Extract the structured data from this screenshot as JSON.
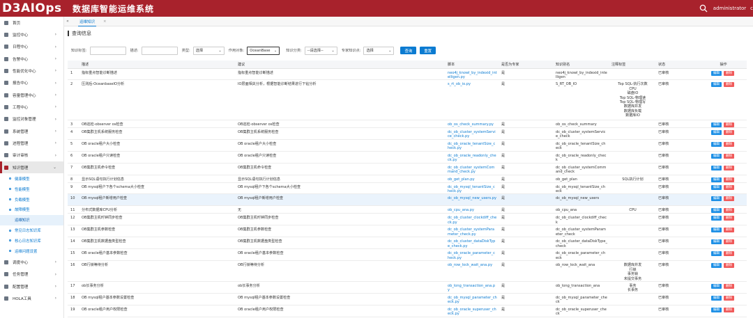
{
  "header": {
    "logo": "D3AIOps",
    "title": "数据库智能运维系统",
    "user": "administrator",
    "user_suffix": "c",
    "icons": {
      "search": "search-icon"
    }
  },
  "sidebar": {
    "items": [
      {
        "label": "首页",
        "icon": "home-icon",
        "chev": false
      },
      {
        "label": "监控中心",
        "icon": "monitor-icon",
        "chev": true
      },
      {
        "label": "日程中心",
        "icon": "calendar-icon",
        "chev": true
      },
      {
        "label": "告警中心",
        "icon": "alarm-icon",
        "chev": true
      },
      {
        "label": "性能优化中心",
        "icon": "performance-icon",
        "chev": true
      },
      {
        "label": "报告中心",
        "icon": "report-icon",
        "chev": true
      },
      {
        "label": "容量管理中心",
        "icon": "capacity-icon",
        "chev": true
      },
      {
        "label": "工程中心",
        "icon": "project-icon",
        "chev": true
      },
      {
        "label": "监控对象管理",
        "icon": "target-icon",
        "chev": true
      },
      {
        "label": "系统管理",
        "icon": "gear-icon",
        "chev": true
      },
      {
        "label": "进程管理",
        "icon": "process-icon",
        "chev": true
      },
      {
        "label": "审计审核",
        "icon": "audit-icon",
        "chev": true
      },
      {
        "label": "知识管理",
        "icon": "knowledge-icon",
        "chev": true,
        "active": true
      }
    ],
    "subitems": [
      "健康模型",
      "性能模型",
      "负载模型",
      "故障模型",
      "运维知识",
      "常见日志知识库",
      "核心日志知识库",
      "运维问题设置"
    ],
    "current_sub": 4,
    "items2": [
      {
        "label": "调度中心",
        "icon": "schedule-icon",
        "chev": true
      },
      {
        "label": "任务管理",
        "icon": "task-icon",
        "chev": true
      },
      {
        "label": "配置管理",
        "icon": "config-icon",
        "chev": true
      },
      {
        "label": "HOLA工具",
        "icon": "tool-icon",
        "chev": true
      }
    ]
  },
  "tabs": {
    "collapse": "«",
    "active": "运维知识",
    "close": "×"
  },
  "page": {
    "section_title": "查询信息"
  },
  "filters": {
    "f1_label": "知识标签:",
    "f2_label": "描述:",
    "f3_label": "类型:",
    "f3_value": "选择",
    "f4_label": "作用对象:",
    "f4_value": "OceanBase",
    "f5_label": "知识分类:",
    "f5_value": "--请选择--",
    "f6_label": "专家知识点:",
    "f6_value": "选择",
    "query": "查询",
    "reset": "重置"
  },
  "table": {
    "headers": [
      "",
      "描述",
      "建议",
      "脚本",
      "是否为专家",
      "知识别名",
      "注释标签",
      "状态",
      "操作"
    ],
    "edit": "编辑",
    "del": "删除",
    "rows": [
      {
        "n": "1",
        "desc": "指标重点智能诊断描述",
        "adv": "指标重点智能诊断描述",
        "script": "neo4j_knowl_by_indexid_intelligen.py",
        "exp": "是",
        "alias": "neo4j_knowl_by_indexid_intelligen",
        "tag": "",
        "status": "已审核"
      },
      {
        "n": "2",
        "desc": "压测后-OceanbaseIO分析",
        "adv": "IO层面相关分析，根据智能诊断结果进行下钻分析",
        "script": "s_rt_ob_io.py",
        "exp": "是",
        "alias": "S_RT_OB_IO",
        "tag": "Top SQL-执行次数\nCPU\n磁盘IO\nTop SQL-物理读\nTop SQL-物理写\n数据库并发\n数据库负载\n数据库IO",
        "status": "已审核"
      },
      {
        "n": "3",
        "desc": "OB巡检-observer os检查",
        "adv": "OB巡检-observer os检查",
        "script": "ob_os_check_summary.py",
        "exp": "是",
        "alias": "ob_os_check_summary",
        "tag": "",
        "status": "已审核"
      },
      {
        "n": "4",
        "desc": "OB集群主机系统服务检查",
        "adv": "OB集群主机系统服务检查",
        "script": "dc_ob_cluster_systemService_check.py",
        "exp": "是",
        "alias": "dc_ob_cluster_systemService_check",
        "tag": "",
        "status": "已审核"
      },
      {
        "n": "5",
        "desc": "OB oracle租户大小检查",
        "adv": "OB oracle租户大小检查",
        "script": "dc_ob_oracle_tenantSize_check.py",
        "exp": "是",
        "alias": "dc_ob_oracle_tenantSize_check",
        "tag": "",
        "status": "已审核"
      },
      {
        "n": "6",
        "desc": "OB oracle租户只读检查",
        "adv": "OB oracle租户只读检查",
        "script": "dc_ob_oracle_readonly_check.py",
        "exp": "是",
        "alias": "dc_ob_oracle_readonly_check",
        "tag": "",
        "status": "已审核"
      },
      {
        "n": "7",
        "desc": "OB集群主机命令检查",
        "adv": "OB集群主机命令检查",
        "script": "dc_ob_cluster_systemCommand_check.py",
        "exp": "是",
        "alias": "dc_ob_cluster_systemCommand_check",
        "tag": "",
        "status": "已审核"
      },
      {
        "n": "8",
        "desc": "显示SQL语句执行计划信息",
        "adv": "显示SQL语句执行计划信息",
        "script": "ob_get_plan.py",
        "exp": "是",
        "alias": "ob_get_plan",
        "tag": "SQL执行计划",
        "status": "已审核"
      },
      {
        "n": "9",
        "desc": "OB mysql租户下各个schema大小检查",
        "adv": "OB mysql租户下各个schema大小检查",
        "script": "dc_ob_mysql_tenantSize_check.py",
        "exp": "是",
        "alias": "dc_ob_mysql_tenantSize_check",
        "tag": "",
        "status": "已审核"
      },
      {
        "n": "10",
        "desc": "OB mysql租户新增用户检查",
        "adv": "OB mysql租户新增用户检查",
        "script": "dc_ob_mysql_new_users.py",
        "exp": "是",
        "alias": "dc_ob_mysql_new_users",
        "tag": "",
        "status": "已审核",
        "hl": true
      },
      {
        "n": "11",
        "desc": "分布式数据库CPU分析",
        "adv": "无",
        "script": "ob_cpu_ana.py",
        "exp": "是",
        "alias": "ob_cpu_ana",
        "tag": "CPU",
        "status": "已审核"
      },
      {
        "n": "12",
        "desc": "OB集群主机时钟同步检查",
        "adv": "OB集群主机时钟同步检查",
        "script": "dc_ob_cluster_clockdiff_check.py",
        "exp": "是",
        "alias": "dc_ob_cluster_clockdiff_check",
        "tag": "",
        "status": "已审核"
      },
      {
        "n": "13",
        "desc": "OB集群主机参数检查",
        "adv": "OB集群主机参数检查",
        "script": "dc_ob_cluster_systemParameter_check.py",
        "exp": "是",
        "alias": "dc_ob_cluster_systemParameter_check",
        "tag": "",
        "status": "已审核"
      },
      {
        "n": "14",
        "desc": "OB集群主机数据盘类型检查",
        "adv": "OB集群主机数据盘类型检查",
        "script": "dc_ob_cluster_dataDiskType_check.py",
        "exp": "是",
        "alias": "dc_ob_cluster_dataDiskType_check",
        "tag": "",
        "status": "已审核"
      },
      {
        "n": "15",
        "desc": "OB oracle租户基本参数检查",
        "adv": "OB oracle租户基本参数检查",
        "script": "dc_ob_oracle_parameter_check.py",
        "exp": "是",
        "alias": "dc_ob_oracle_parameter_check",
        "tag": "",
        "status": "已审核"
      },
      {
        "n": "16",
        "desc": "OB行锁等待分析",
        "adv": "OB行锁等待分析",
        "script": "ob_row_lock_wait_ana.py",
        "exp": "是",
        "alias": "ob_row_lock_wait_ana",
        "tag": "数据库并发\n行锁\n事务锁\n未提交事务",
        "status": "已审核"
      },
      {
        "n": "17",
        "desc": "ob长事务分析",
        "adv": "ob长事务分析",
        "script": "ob_long_transaction_ana.py",
        "exp": "是",
        "alias": "ob_long_transaction_ana",
        "tag": "事务\n长事务",
        "status": "已审核"
      },
      {
        "n": "18",
        "desc": "OB mysql租户基本参数设置检查",
        "adv": "OB mysql租户基本参数设置检查",
        "script": "dc_ob_mysql_parameter_check.py",
        "exp": "是",
        "alias": "dc_ob_mysql_parameter_check",
        "tag": "",
        "status": "已审核"
      },
      {
        "n": "19",
        "desc": "OB oracle租户用户权限检查",
        "adv": "OB oracle租户用户权限检查",
        "script": "dc_ob_oracle_superuser_check.py",
        "exp": "是",
        "alias": "dc_ob_oracle_superuser_check",
        "tag": "",
        "status": "已审核"
      }
    ]
  }
}
